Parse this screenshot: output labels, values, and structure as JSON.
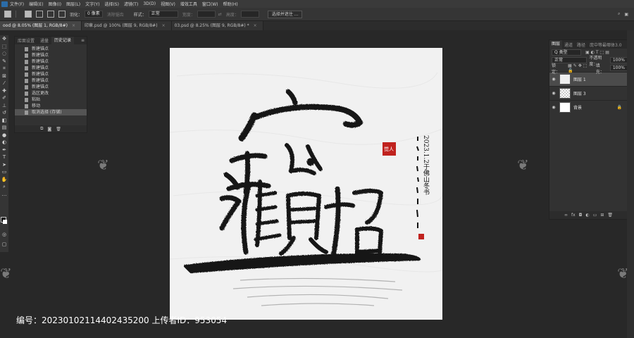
{
  "menubar": {
    "items": [
      "文件(F)",
      "编辑(E)",
      "图像(I)",
      "图层(L)",
      "文字(Y)",
      "选择(S)",
      "滤镜(T)",
      "3D(D)",
      "视图(V)",
      "增效工具",
      "窗口(W)",
      "帮助(H)"
    ]
  },
  "options": {
    "feather_label": "羽化：",
    "feather_value": "0 像素",
    "antialias_label": "消除锯齿",
    "style_label": "样式：",
    "style_value": "正常",
    "width_label": "宽度：",
    "height_label": "高度：",
    "select_mask_button": "选择并遮住 ..."
  },
  "tabs": [
    {
      "label": "ood @ 8.05% (图层 1, RGB/8#)",
      "active": true
    },
    {
      "label": "印章.psd @ 100% (图层 9, RGB/8#)",
      "active": false
    },
    {
      "label": "03.psd @ 8.25% (图层 9, RGB/8#) *",
      "active": false
    }
  ],
  "history_panel": {
    "tabs": [
      "库",
      "调整",
      "历史记录"
    ],
    "tab_labels_full": [
      "库面设置",
      "通量",
      "历史记录"
    ],
    "items": [
      {
        "label": "新建锚点"
      },
      {
        "label": "新建锚点"
      },
      {
        "label": "新建锚点"
      },
      {
        "label": "新建锚点"
      },
      {
        "label": "新建锚点"
      },
      {
        "label": "新建锚点"
      },
      {
        "label": "新建锚点"
      },
      {
        "label": "选区更改"
      },
      {
        "label": "粘贴"
      },
      {
        "label": "移动"
      },
      {
        "label": "取消选择 (存储)",
        "selected": true
      }
    ]
  },
  "layers_panel": {
    "tabs": [
      "图层",
      "通道",
      "路径",
      "庞中等最哪体3.0"
    ],
    "filter_label": "Q 类型",
    "blend_mode": "正常",
    "opacity_label": "不透明度：",
    "opacity_value": "100%",
    "lock_label": "锁定：",
    "fill_label": "填充：",
    "fill_value": "100%",
    "layers": [
      {
        "name": "图层 1",
        "selected": true,
        "thumb": "art"
      },
      {
        "name": "图层 3",
        "selected": false,
        "thumb": "checker"
      },
      {
        "name": "背景",
        "selected": false,
        "thumb": "white",
        "locked": true
      }
    ]
  },
  "artwork": {
    "main_text": "迎財招寶",
    "date_inscription": "2023.1.2于佛山冬书",
    "seal_text": "觉人"
  },
  "footer": {
    "caption": "编号：20230102114402435200 上传者ID：953054"
  }
}
